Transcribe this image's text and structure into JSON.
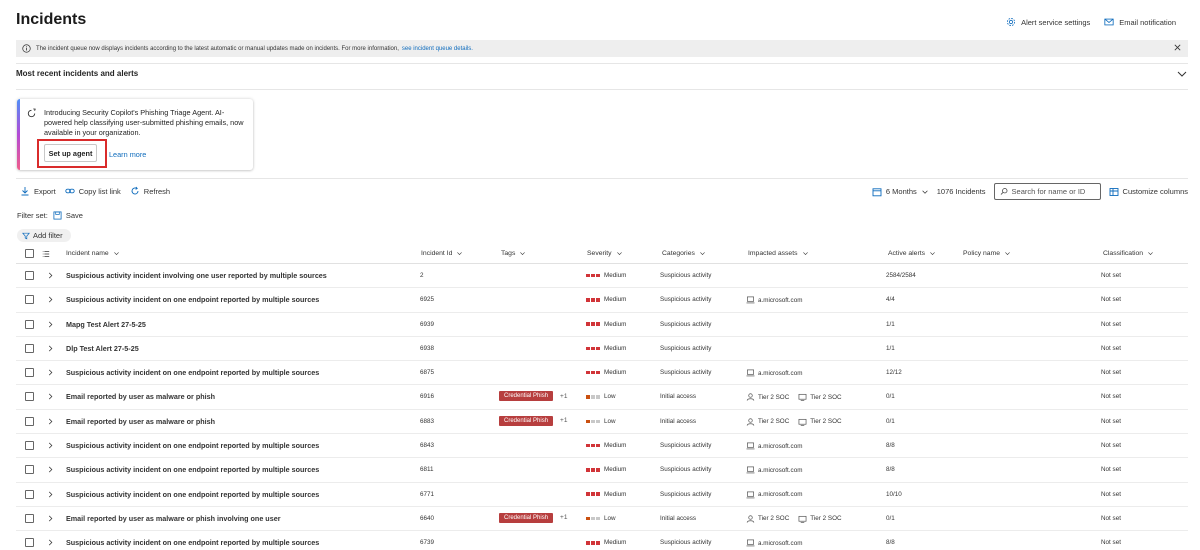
{
  "page": {
    "title": "Incidents"
  },
  "header": {
    "alert_settings_label": "Alert service settings",
    "email_notification_label": "Email notification"
  },
  "info_bar": {
    "text": "The incident queue now displays incidents according to the latest automatic or manual updates made on incidents. For more information,",
    "link_text": "see incident queue details."
  },
  "recent": {
    "title": "Most recent incidents and alerts"
  },
  "copilot_card": {
    "text": "Introducing Security Copilot's Phishing Triage Agent. AI-powered help classifying user-submitted phishing emails, now available in your organization.",
    "setup_label": "Set up agent",
    "learn_more_label": "Learn more"
  },
  "toolbar": {
    "export_label": "Export",
    "copy_link_label": "Copy list link",
    "refresh_label": "Refresh",
    "time_range": "6 Months",
    "count_label": "1076 Incidents",
    "search_placeholder": "Search for name or ID",
    "customize_label": "Customize columns"
  },
  "filters": {
    "filterset_label": "Filter set:",
    "save_label": "Save",
    "add_filter_label": "Add filter"
  },
  "columns": {
    "name": "Incident name",
    "id": "Incident Id",
    "tags": "Tags",
    "severity": "Severity",
    "categories": "Categories",
    "assets": "Impacted assets",
    "alerts": "Active alerts",
    "policy": "Policy name",
    "classification": "Classification"
  },
  "colors": {
    "severity_medium": [
      "#d13438",
      "#d13438",
      "#d13438"
    ],
    "severity_low": [
      "#ca5010",
      "#c8c8c8",
      "#c8c8c8"
    ],
    "tag_bg": "#b73e3e",
    "link": "#0f6cbd"
  },
  "rows": [
    {
      "name": "Suspicious activity incident involving one user reported by multiple sources",
      "id": "2",
      "tag": "",
      "tag_more": "",
      "severity": "Medium",
      "category": "Suspicious activity",
      "asset_type": "",
      "asset1": "",
      "asset2": "",
      "alerts": "2584/2584",
      "policy": "",
      "classification": "Not set"
    },
    {
      "name": "Suspicious activity incident on one endpoint reported by multiple sources",
      "id": "6925",
      "tag": "",
      "tag_more": "",
      "severity": "Medium",
      "category": "Suspicious activity",
      "asset_type": "device",
      "asset1": "a.microsoft.com",
      "asset2": "",
      "alerts": "4/4",
      "policy": "",
      "classification": "Not set"
    },
    {
      "name": "Mapg Test Alert 27-5-25",
      "id": "6939",
      "tag": "",
      "tag_more": "",
      "severity": "Medium",
      "category": "Suspicious activity",
      "asset_type": "",
      "asset1": "",
      "asset2": "",
      "alerts": "1/1",
      "policy": "",
      "classification": "Not set"
    },
    {
      "name": "Dlp Test Alert 27-5-25",
      "id": "6938",
      "tag": "",
      "tag_more": "",
      "severity": "Medium",
      "category": "Suspicious activity",
      "asset_type": "",
      "asset1": "",
      "asset2": "",
      "alerts": "1/1",
      "policy": "",
      "classification": "Not set"
    },
    {
      "name": "Suspicious activity incident on one endpoint reported by multiple sources",
      "id": "6875",
      "tag": "",
      "tag_more": "",
      "severity": "Medium",
      "category": "Suspicious activity",
      "asset_type": "device",
      "asset1": "a.microsoft.com",
      "asset2": "",
      "alerts": "12/12",
      "policy": "",
      "classification": "Not set"
    },
    {
      "name": "Email reported by user as malware or phish",
      "id": "6916",
      "tag": "Credential Phish",
      "tag_more": "+1",
      "severity": "Low",
      "category": "Initial access",
      "asset_type": "user",
      "asset1": "Tier 2 SOC",
      "asset2": "Tier 2 SOC",
      "alerts": "0/1",
      "policy": "",
      "classification": "Not set"
    },
    {
      "name": "Email reported by user as malware or phish",
      "id": "6883",
      "tag": "Credential Phish",
      "tag_more": "+1",
      "severity": "Low",
      "category": "Initial access",
      "asset_type": "user",
      "asset1": "Tier 2 SOC",
      "asset2": "Tier 2 SOC",
      "alerts": "0/1",
      "policy": "",
      "classification": "Not set"
    },
    {
      "name": "Suspicious activity incident on one endpoint reported by multiple sources",
      "id": "6843",
      "tag": "",
      "tag_more": "",
      "severity": "Medium",
      "category": "Suspicious activity",
      "asset_type": "device",
      "asset1": "a.microsoft.com",
      "asset2": "",
      "alerts": "8/8",
      "policy": "",
      "classification": "Not set"
    },
    {
      "name": "Suspicious activity incident on one endpoint reported by multiple sources",
      "id": "6811",
      "tag": "",
      "tag_more": "",
      "severity": "Medium",
      "category": "Suspicious activity",
      "asset_type": "device",
      "asset1": "a.microsoft.com",
      "asset2": "",
      "alerts": "8/8",
      "policy": "",
      "classification": "Not set"
    },
    {
      "name": "Suspicious activity incident on one endpoint reported by multiple sources",
      "id": "6771",
      "tag": "",
      "tag_more": "",
      "severity": "Medium",
      "category": "Suspicious activity",
      "asset_type": "device",
      "asset1": "a.microsoft.com",
      "asset2": "",
      "alerts": "10/10",
      "policy": "",
      "classification": "Not set"
    },
    {
      "name": "Email reported by user as malware or phish involving one user",
      "id": "6640",
      "tag": "Credential Phish",
      "tag_more": "+1",
      "severity": "Low",
      "category": "Initial access",
      "asset_type": "user",
      "asset1": "Tier 2 SOC",
      "asset2": "Tier 2 SOC",
      "alerts": "0/1",
      "policy": "",
      "classification": "Not set"
    },
    {
      "name": "Suspicious activity incident on one endpoint reported by multiple sources",
      "id": "6739",
      "tag": "",
      "tag_more": "",
      "severity": "Medium",
      "category": "Suspicious activity",
      "asset_type": "device",
      "asset1": "a.microsoft.com",
      "asset2": "",
      "alerts": "8/8",
      "policy": "",
      "classification": "Not set"
    }
  ]
}
